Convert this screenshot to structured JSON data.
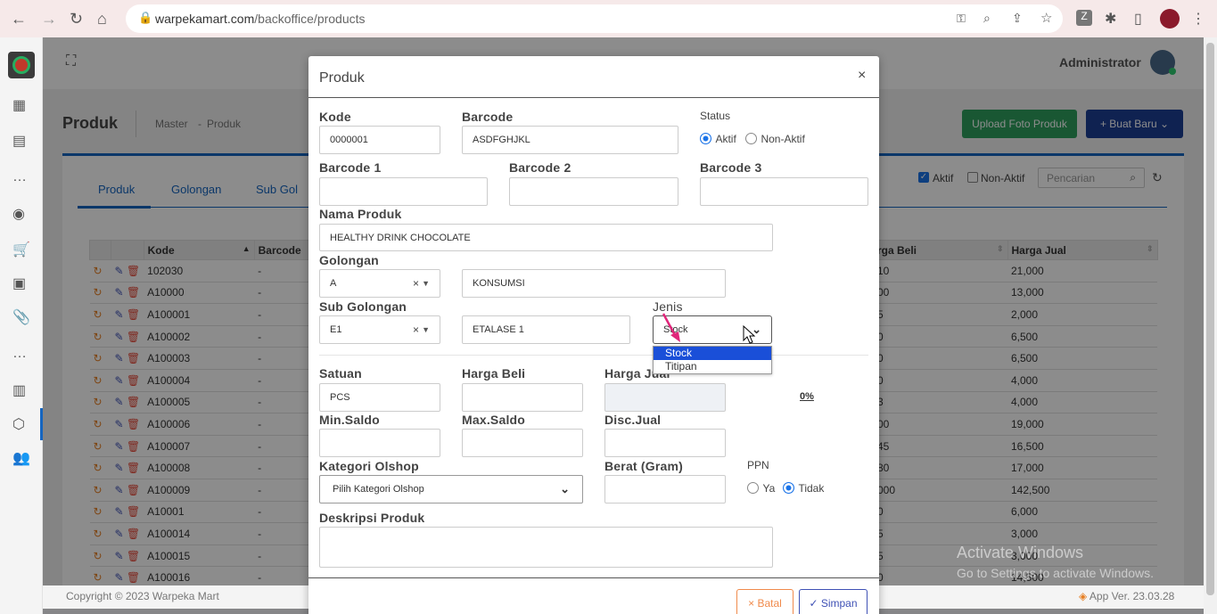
{
  "browser": {
    "url_domain": "warpekamart.com",
    "url_path": "/backoffice/products"
  },
  "app": {
    "user": "Administrator",
    "page_title": "Produk",
    "breadcrumb_master": "Master",
    "breadcrumb_sep": "-",
    "breadcrumb_current": "Produk",
    "upload_button": "Upload Foto Produk",
    "new_button": "+ Buat Baru",
    "tabs": [
      "Produk",
      "Golongan",
      "Sub Gol"
    ],
    "filter_active": "Aktif",
    "filter_inactive": "Non-Aktif",
    "search_placeholder": "Pencarian",
    "footer_copyright": "Copyright © 2023 Warpeka Mart",
    "footer_version": "App Ver. 23.03.28"
  },
  "table": {
    "headers": {
      "kode": "Kode",
      "barcode": "Barcode",
      "harga_beli": "rga Beli",
      "harga_jual": "Harga Jual"
    },
    "rows": [
      {
        "kode": "102030",
        "barcode": "-",
        "beli": "10",
        "jual": "21,000"
      },
      {
        "kode": "A10000",
        "barcode": "-",
        "beli": "00",
        "jual": "13,000"
      },
      {
        "kode": "A100001",
        "barcode": "-",
        "beli": "5",
        "jual": "2,000"
      },
      {
        "kode": "A100002",
        "barcode": "-",
        "beli": "0",
        "jual": "6,500"
      },
      {
        "kode": "A100003",
        "barcode": "-",
        "beli": "0",
        "jual": "6,500"
      },
      {
        "kode": "A100004",
        "barcode": "-",
        "beli": "0",
        "jual": "4,000"
      },
      {
        "kode": "A100005",
        "barcode": "-",
        "beli": "3",
        "jual": "4,000"
      },
      {
        "kode": "A100006",
        "barcode": "-",
        "beli": "00",
        "jual": "19,000"
      },
      {
        "kode": "A100007",
        "barcode": "-",
        "beli": "45",
        "jual": "16,500"
      },
      {
        "kode": "A100008",
        "barcode": "-",
        "beli": "80",
        "jual": "17,000"
      },
      {
        "kode": "A100009",
        "barcode": "-",
        "beli": "000",
        "jual": "142,500"
      },
      {
        "kode": "A10001",
        "barcode": "-",
        "beli": "0",
        "jual": "6,000"
      },
      {
        "kode": "A100014",
        "barcode": "-",
        "beli": "5",
        "jual": "3,000"
      },
      {
        "kode": "A100015",
        "barcode": "-",
        "beli": "5",
        "jual": "3,000"
      },
      {
        "kode": "A100016",
        "barcode": "-",
        "beli": "0",
        "jual": "14,500"
      }
    ]
  },
  "watermark": {
    "line1": "Activate Windows",
    "line2": "Go to Settings to activate Windows."
  },
  "modal": {
    "title": "Produk",
    "close": "×",
    "kode_label": "Kode",
    "kode_value": "0000001",
    "barcode_label": "Barcode",
    "barcode_value": "ASDFGHJKL",
    "status_label": "Status",
    "status_active": "Aktif",
    "status_inactive": "Non-Aktif",
    "barcode1_label": "Barcode 1",
    "barcode2_label": "Barcode 2",
    "barcode3_label": "Barcode 3",
    "nama_label": "Nama Produk",
    "nama_value": "HEALTHY DRINK CHOCOLATE",
    "golongan_label": "Golongan",
    "golongan_code": "A",
    "golongan_name": "KONSUMSI",
    "subgol_label": "Sub Golongan",
    "subgol_code": "E1",
    "subgol_name": "ETALASE 1",
    "jenis_label": "Jenis",
    "jenis_value": "Stock",
    "jenis_options": [
      "Stock",
      "Titipan"
    ],
    "satuan_label": "Satuan",
    "satuan_value": "PCS",
    "harga_beli_label": "Harga Beli",
    "harga_jual_label": "Harga Jual",
    "margin": "0%",
    "min_label": "Min.Saldo",
    "max_label": "Max.Saldo",
    "disc_label": "Disc.Jual",
    "kategori_label": "Kategori Olshop",
    "kategori_value": "Pilih Kategori Olshop",
    "berat_label": "Berat (Gram)",
    "ppn_label": "PPN",
    "ppn_yes": "Ya",
    "ppn_no": "Tidak",
    "desc_label": "Deskripsi Produk",
    "cancel": "× Batal",
    "save": "✓ Simpan",
    "clear_x": "×"
  }
}
